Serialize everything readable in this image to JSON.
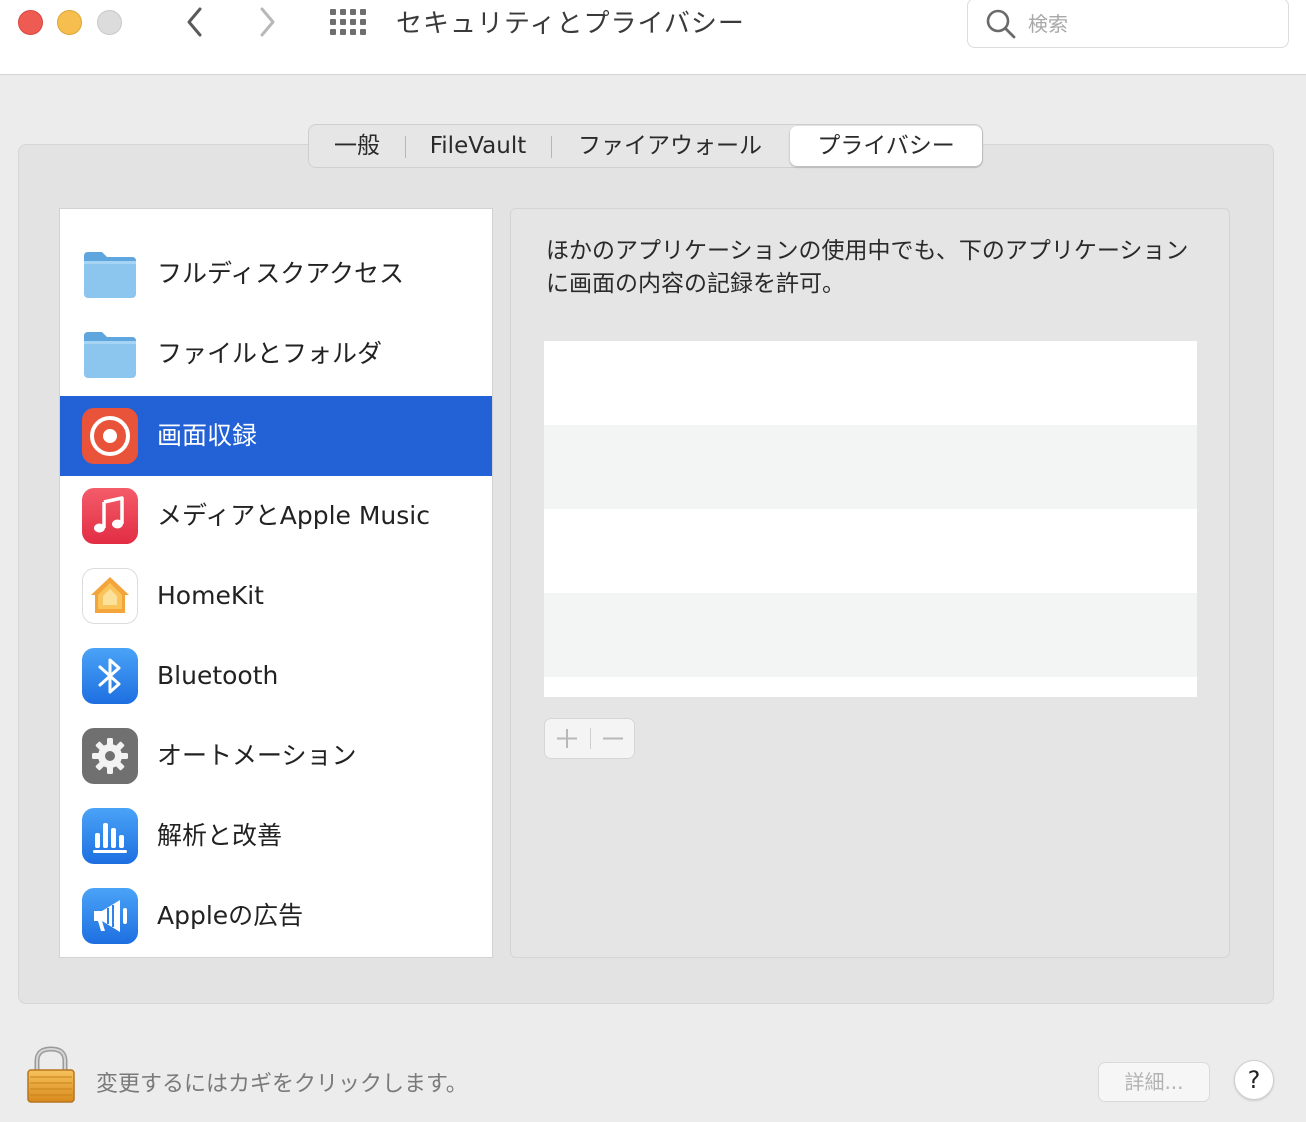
{
  "window": {
    "title": "セキュリティとプライバシー",
    "search_placeholder": "検索"
  },
  "tabs": [
    {
      "label": "一般",
      "active": false
    },
    {
      "label": "FileVault",
      "active": false
    },
    {
      "label": "ファイアウォール",
      "active": false
    },
    {
      "label": "プライバシー",
      "active": true
    }
  ],
  "sidebar": {
    "items": [
      {
        "label": "フルディスクアクセス",
        "icon": "folder-icon",
        "selected": false
      },
      {
        "label": "ファイルとフォルダ",
        "icon": "folder-icon",
        "selected": false
      },
      {
        "label": "画面収録",
        "icon": "screen-recording-icon",
        "selected": true
      },
      {
        "label": "メディアとApple Music",
        "icon": "music-icon",
        "selected": false
      },
      {
        "label": "HomeKit",
        "icon": "home-icon",
        "selected": false
      },
      {
        "label": "Bluetooth",
        "icon": "bluetooth-icon",
        "selected": false
      },
      {
        "label": "オートメーション",
        "icon": "gear-icon",
        "selected": false
      },
      {
        "label": "解析と改善",
        "icon": "analytics-icon",
        "selected": false
      },
      {
        "label": "Appleの広告",
        "icon": "megaphone-icon",
        "selected": false
      }
    ]
  },
  "main": {
    "description": "ほかのアプリケーションの使用中でも、下のアプリケーションに画面の内容の記録を許可。",
    "add_button": "+",
    "remove_button": "−"
  },
  "footer": {
    "lock_text": "変更するにはカギをクリックします。",
    "detail_button": "詳細...",
    "help_button": "?"
  },
  "colors": {
    "selection": "#2362d6",
    "close": "#ee5b52",
    "minimize": "#f5be4f"
  }
}
